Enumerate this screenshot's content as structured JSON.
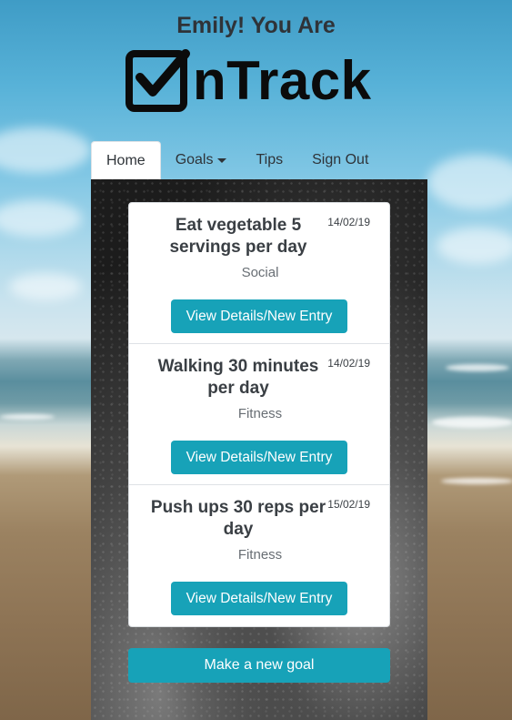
{
  "header": {
    "greeting": "Emily! You Are",
    "logo_text": "nTrack",
    "logo_icon": "checkbox-check-icon"
  },
  "nav": {
    "items": [
      {
        "label": "Home",
        "active": true
      },
      {
        "label": "Goals",
        "dropdown": true
      },
      {
        "label": "Tips"
      },
      {
        "label": "Sign Out"
      }
    ]
  },
  "goals": [
    {
      "title": "Eat vegetable 5 servings per day",
      "date": "14/02/19",
      "category": "Social",
      "button": "View Details/New Entry"
    },
    {
      "title": "Walking 30 minutes per day",
      "date": "14/02/19",
      "category": "Fitness",
      "button": "View Details/New Entry"
    },
    {
      "title": "Push ups 30 reps per day",
      "date": "15/02/19",
      "category": "Fitness",
      "button": "View Details/New Entry"
    }
  ],
  "actions": {
    "new_goal": "Make a new goal"
  },
  "colors": {
    "accent": "#17a2b8",
    "text": "#3a3f44",
    "muted": "#686e74"
  }
}
